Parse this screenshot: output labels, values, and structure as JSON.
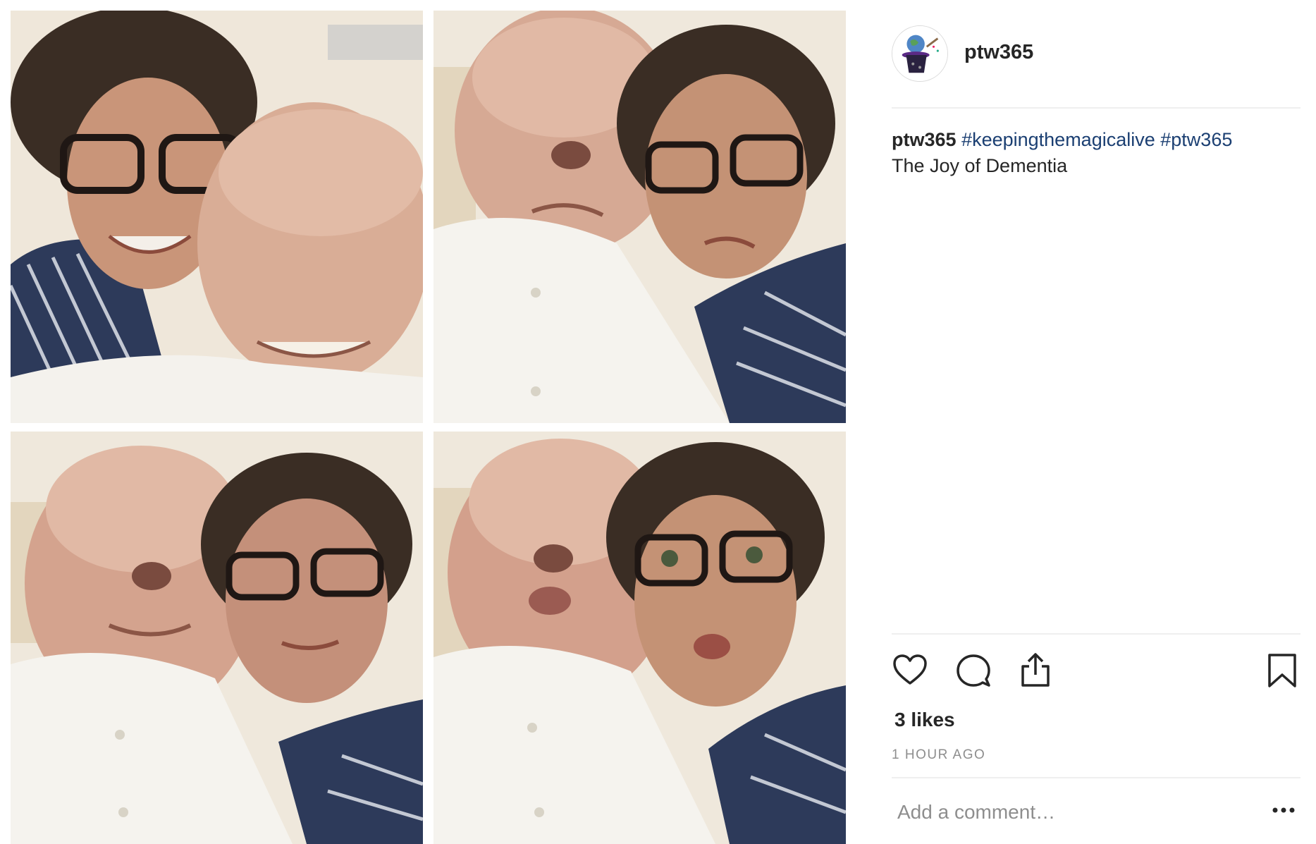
{
  "post": {
    "username": "ptw365",
    "caption": {
      "user": "ptw365",
      "hashtags": [
        "#keepingthemagicalive",
        "#ptw365"
      ],
      "text": "The Joy of Dementia"
    },
    "likes": "3 likes",
    "timestamp": "1 HOUR AGO",
    "comment_placeholder": "Add a comment…"
  },
  "icons": {
    "like": "heart-icon",
    "comment": "speech-bubble-icon",
    "share": "share-icon",
    "save": "bookmark-icon",
    "more": "more-dots-icon"
  },
  "colors": {
    "hashtag": "#1b3f72",
    "text": "#262626",
    "muted": "#8e8e8e",
    "divider": "#efefef"
  }
}
